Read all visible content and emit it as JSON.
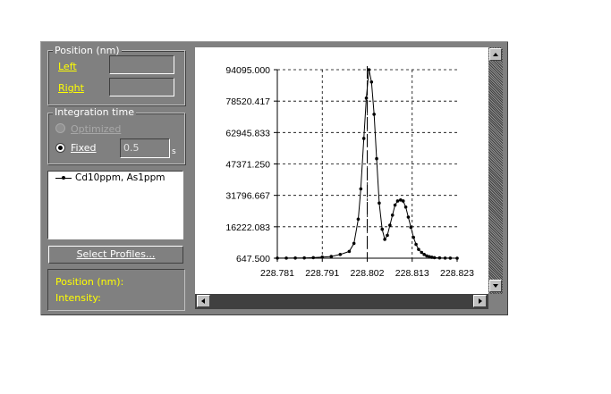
{
  "position_group": {
    "title": "Position (nm)",
    "left_label": "Left",
    "right_label": "Right",
    "left_value": "",
    "right_value": ""
  },
  "integration_group": {
    "title": "Integration time",
    "optimized_label": "Optimized",
    "fixed_label": "Fixed",
    "fixed_value": "0.5",
    "unit": "s",
    "selected": "fixed"
  },
  "legend": {
    "items": [
      {
        "label": "Cd10ppm, As1ppm",
        "icon": "line-with-dot-marker"
      }
    ]
  },
  "select_profiles_label": "Select Profiles...",
  "readout": {
    "position_label": "Position (nm):",
    "intensity_label": "Intensity:"
  },
  "colors": {
    "panel": "#808080",
    "label_yellow": "#ffff00",
    "plot_bg": "#ffffff"
  },
  "chart_data": {
    "type": "line",
    "title": "",
    "xlabel": "",
    "ylabel": "",
    "x_ticks": [
      "228.781",
      "228.791",
      "228.802",
      "228.813",
      "228.823"
    ],
    "y_ticks": [
      "647.500",
      "16222.083",
      "31796.667",
      "47371.250",
      "62945.833",
      "78520.417",
      "94095.000"
    ],
    "xlim": [
      228.781,
      228.823
    ],
    "ylim": [
      647.5,
      94095
    ],
    "grid": true,
    "marker_line_x": 228.802,
    "series": [
      {
        "name": "Cd10ppm, As1ppm",
        "x": [
          228.781,
          228.7831,
          228.7852,
          228.7873,
          228.7894,
          228.7915,
          228.7936,
          228.7957,
          228.7978,
          228.7989,
          228.7999,
          228.8005,
          228.8012,
          228.8018,
          228.8024,
          228.803,
          228.8036,
          228.8042,
          228.8048,
          228.8055,
          228.8061,
          228.8067,
          228.8073,
          228.8079,
          228.8085,
          228.8091,
          228.8098,
          228.8104,
          228.811,
          228.8116,
          228.8122,
          228.8128,
          228.8134,
          228.814,
          228.8147,
          228.8153,
          228.8159,
          228.8165,
          228.8171,
          228.8177,
          228.8189,
          228.8202,
          228.8214,
          228.823
        ],
        "y": [
          700,
          700,
          750,
          800,
          900,
          1200,
          1500,
          2500,
          4000,
          8000,
          20000,
          35000,
          60000,
          80000,
          94095,
          88000,
          72000,
          50000,
          28000,
          15000,
          10000,
          12000,
          17000,
          22000,
          27000,
          29000,
          29500,
          29000,
          26000,
          21000,
          16000,
          11000,
          7500,
          5000,
          3500,
          2500,
          1800,
          1400,
          1100,
          900,
          800,
          700,
          680,
          650
        ]
      }
    ]
  }
}
